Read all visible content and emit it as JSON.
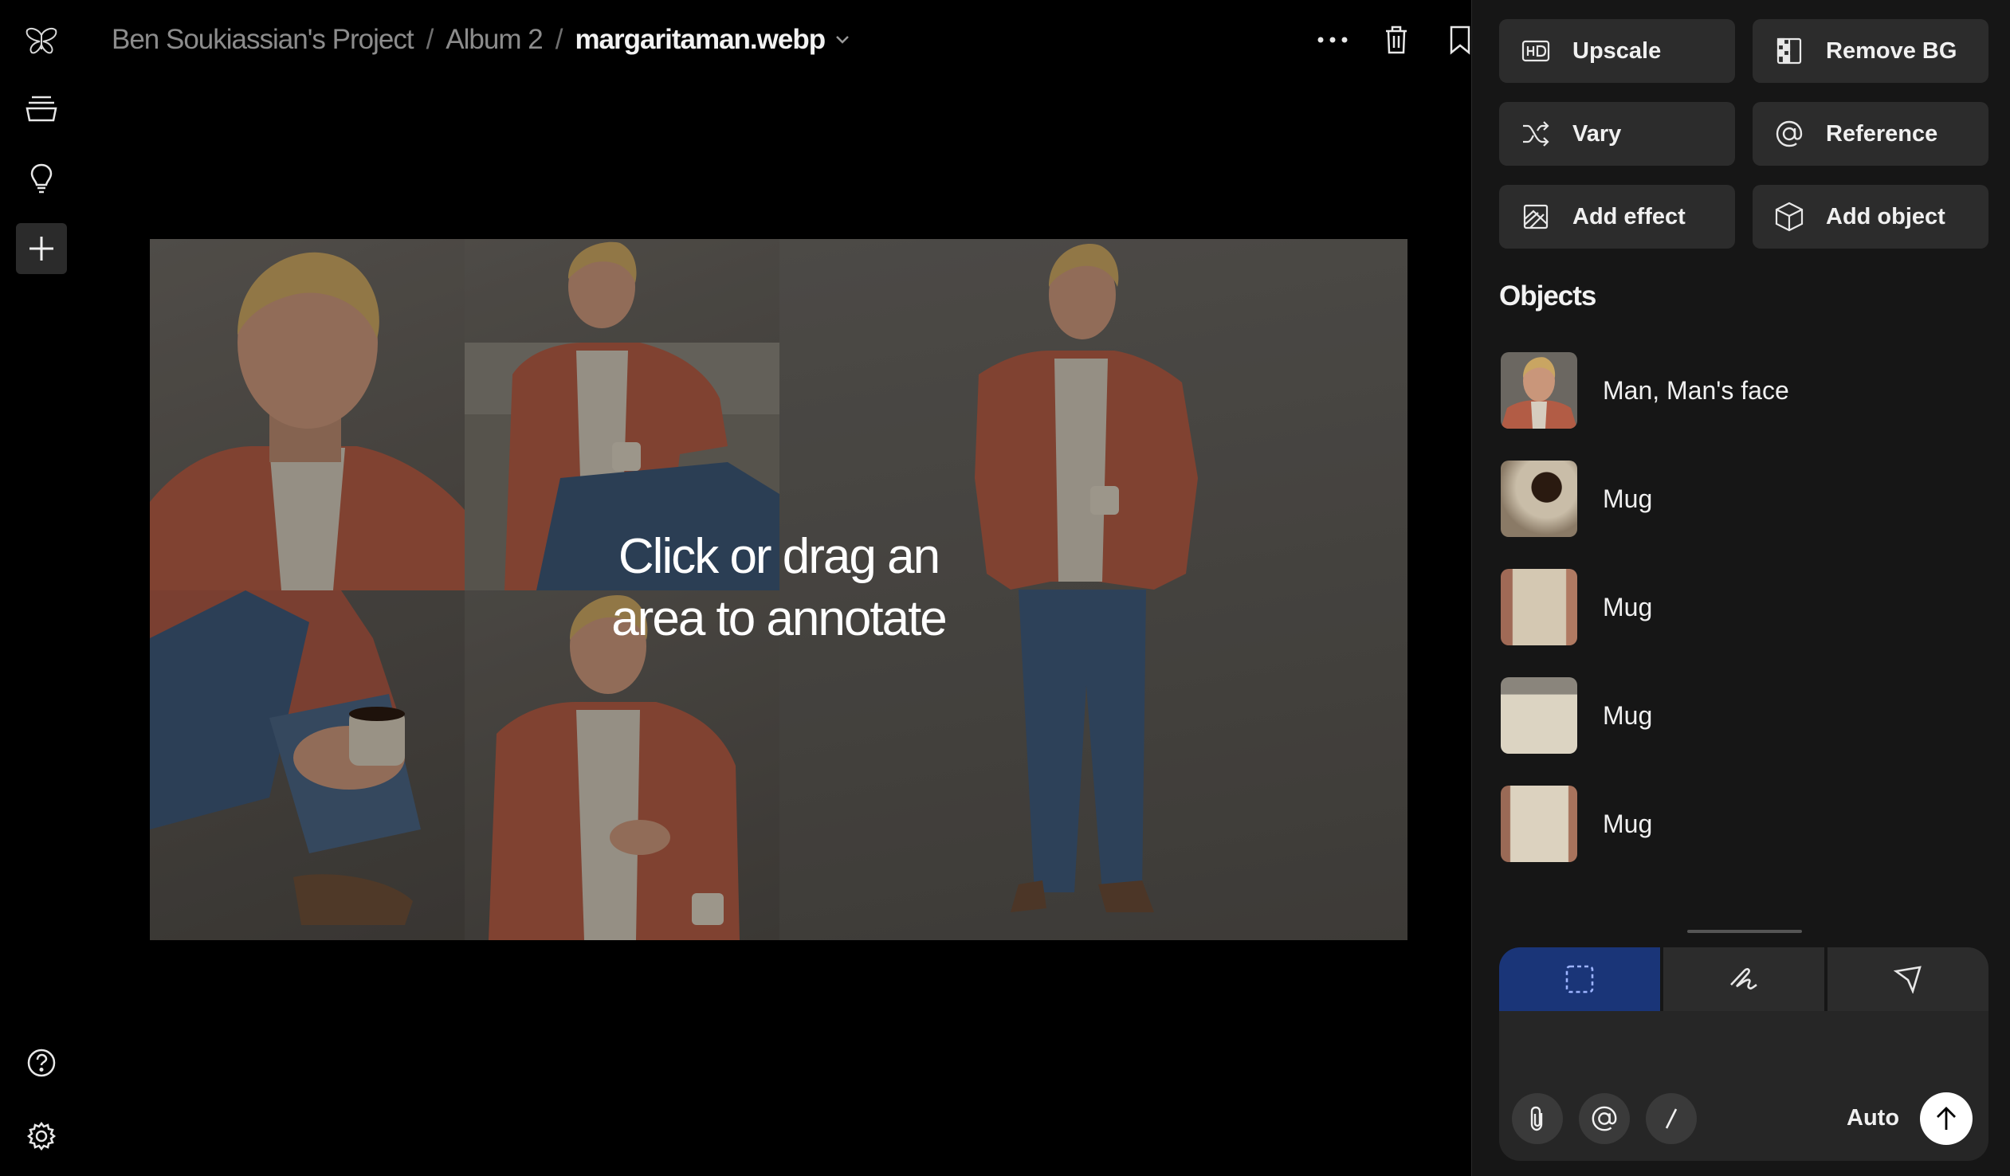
{
  "breadcrumb": {
    "project": "Ben Soukiassian's Project",
    "album": "Album 2",
    "file": "margaritaman.webp"
  },
  "icons": {
    "logo": "butterfly-logo-icon",
    "library": "stack-icon",
    "ideas": "lightbulb-icon",
    "new": "plus-icon",
    "help": "help-circle-icon",
    "settings": "gear-icon",
    "more": "more-horizontal-icon",
    "delete": "trash-icon",
    "bookmark": "bookmark-icon",
    "download": "download-icon"
  },
  "canvas": {
    "hint_line1": "Click or drag an",
    "hint_line2": "area to annotate"
  },
  "actions": {
    "upscale": "Upscale",
    "remove_bg": "Remove BG",
    "vary": "Vary",
    "reference": "Reference",
    "add_effect": "Add effect",
    "add_object": "Add object"
  },
  "objects": {
    "title": "Objects",
    "items": [
      {
        "label": "Man, Man's face"
      },
      {
        "label": "Mug"
      },
      {
        "label": "Mug"
      },
      {
        "label": "Mug"
      },
      {
        "label": "Mug"
      }
    ]
  },
  "annotate": {
    "modes": [
      "select-area",
      "draw",
      "pointer"
    ],
    "active_mode": "select-area",
    "model": "Auto"
  },
  "colors": {
    "active_mode_bg": "#1a3578",
    "panel_bg": "#161616",
    "button_bg": "#2c2c2c"
  }
}
